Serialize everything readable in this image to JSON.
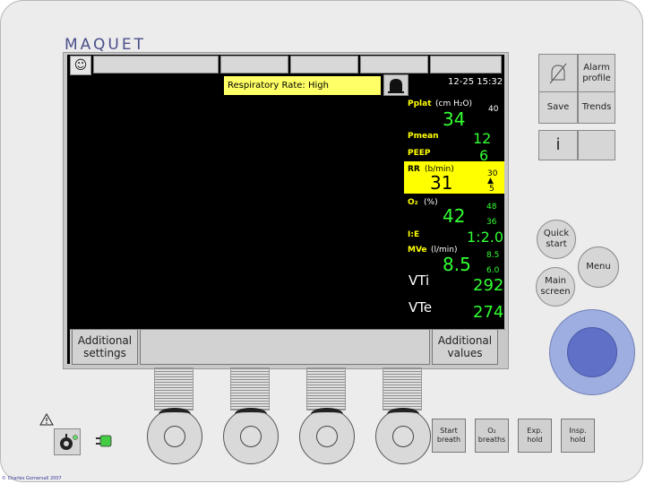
{
  "brand": {
    "logo": "MAQUET"
  },
  "header": {
    "alarm_message": "Respiratory Rate: High",
    "datetime": "12-25 15:32",
    "patient_icon": "person-icon",
    "bell_icon": "alarm-silence-bell-icon"
  },
  "parameters": {
    "pplat": {
      "label": "Pplat",
      "unit": "(cm H₂O)",
      "value": "34",
      "upper": "40"
    },
    "pmean": {
      "label": "Pmean",
      "value": "12"
    },
    "peep": {
      "label": "PEEP",
      "value": "6"
    },
    "rr": {
      "label": "RR",
      "unit": "(b/min)",
      "value": "31",
      "upper": "30",
      "lower": "5"
    },
    "o2": {
      "label": "O₂",
      "unit": "(%)",
      "value": "42",
      "upper": "48",
      "lower": "36"
    },
    "ie": {
      "label": "I:E",
      "value": "1:2.0"
    },
    "mve": {
      "label": "MVe",
      "unit": "(l/min)",
      "value": "8.5",
      "upper": "8.5",
      "lower": "6.0"
    },
    "vti": {
      "label": "VTi",
      "value": "292"
    },
    "vte": {
      "label": "VTe",
      "value": "274"
    }
  },
  "bottom": {
    "additional_settings": "Additional settings",
    "additional_values": "Additional values"
  },
  "side_panel": {
    "alarm_profile": "Alarm profile",
    "save": "Save",
    "trends": "Trends",
    "info": "i",
    "quick_start": "Quick start",
    "menu": "Menu",
    "main_screen": "Main screen"
  },
  "lower_panel": {
    "start_breath": "Start breath",
    "o2_breaths": "O₂ breaths",
    "exp_hold": "Exp. hold",
    "insp_hold": "Insp. hold"
  },
  "footer": {
    "copyright": "© Charles Gomersall 2007"
  },
  "colors": {
    "alarm": "#ffff00",
    "value": "#33ff33",
    "dial": "#5f70c6"
  }
}
